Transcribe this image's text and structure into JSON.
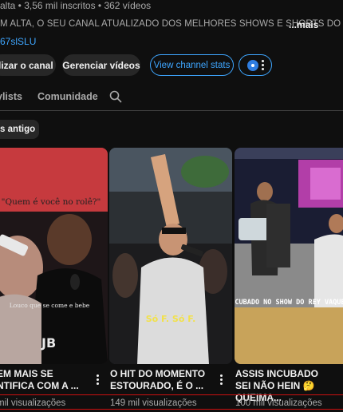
{
  "channel": {
    "meta": "alta • 3,56 mil inscritos • 362 vídeos",
    "description": "M ALTA, O SEU CANAL ATUALIZADO DOS MELHORES SHOWS E SHORTS DO",
    "more_label": "...mais",
    "link": "67slSLU"
  },
  "actions": {
    "customize_label": "alizar o canal",
    "manage_label": "Gerenciar vídeos",
    "stats_label": "View channel stats"
  },
  "tabs": {
    "playlists": "ylists",
    "community": "Comunidade"
  },
  "filter_chip": "is antigo",
  "videos": [
    {
      "title": "EM MAIS SE NTIFICA COM A ...",
      "views": "mil visualizações",
      "overlay_text": "\"Quem é você no rolê?\"",
      "overlay_text_2": "Louco que se come e bebe",
      "watermark": "JB"
    },
    {
      "title": "O HIT DO MOMENTO ESTOURADO, É O ...",
      "views": "149 mil visualizações",
      "overlay_text": "Só F. Só F."
    },
    {
      "title": "ASSIS INCUBADO SEI NÃO HEIN 🤔 QUEIMA...",
      "views": "100 mil visualizações",
      "overlay_text": "INCUBADO NO SHOW DO REY VAQUEIRO"
    }
  ],
  "colors": {
    "background": "#0f0f0f",
    "accent_link": "#3ea6ff",
    "chip_bg": "#272727"
  }
}
